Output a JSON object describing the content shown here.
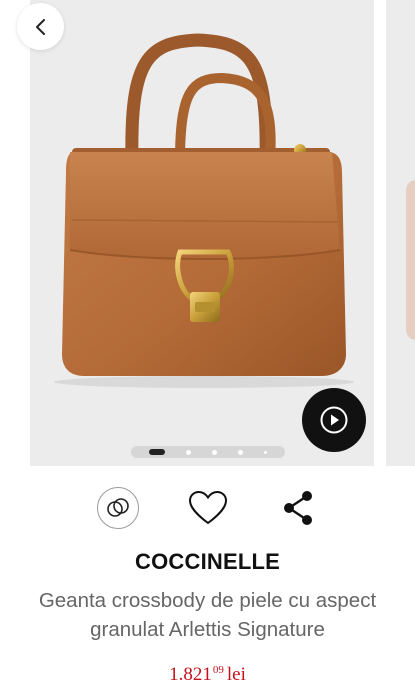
{
  "gallery": {
    "back_icon": "chevron-left-icon",
    "video_icon": "play-circle-icon",
    "carousel": {
      "slide_count": 5,
      "active_index": 0
    }
  },
  "actions": {
    "compare_icon": "compare-rings-icon",
    "favorite_icon": "heart-icon",
    "share_icon": "share-icon"
  },
  "product": {
    "brand": "COCCINELLE",
    "title": "Geanta crossbody de piele cu aspect granulat Arlettis Signature",
    "price": {
      "main": "1.821",
      "decimals": "09",
      "currency": "lei"
    }
  },
  "colors": {
    "price": "#c4121c",
    "brand": "#111111",
    "title": "#666666",
    "bag": "#b86e3c"
  }
}
